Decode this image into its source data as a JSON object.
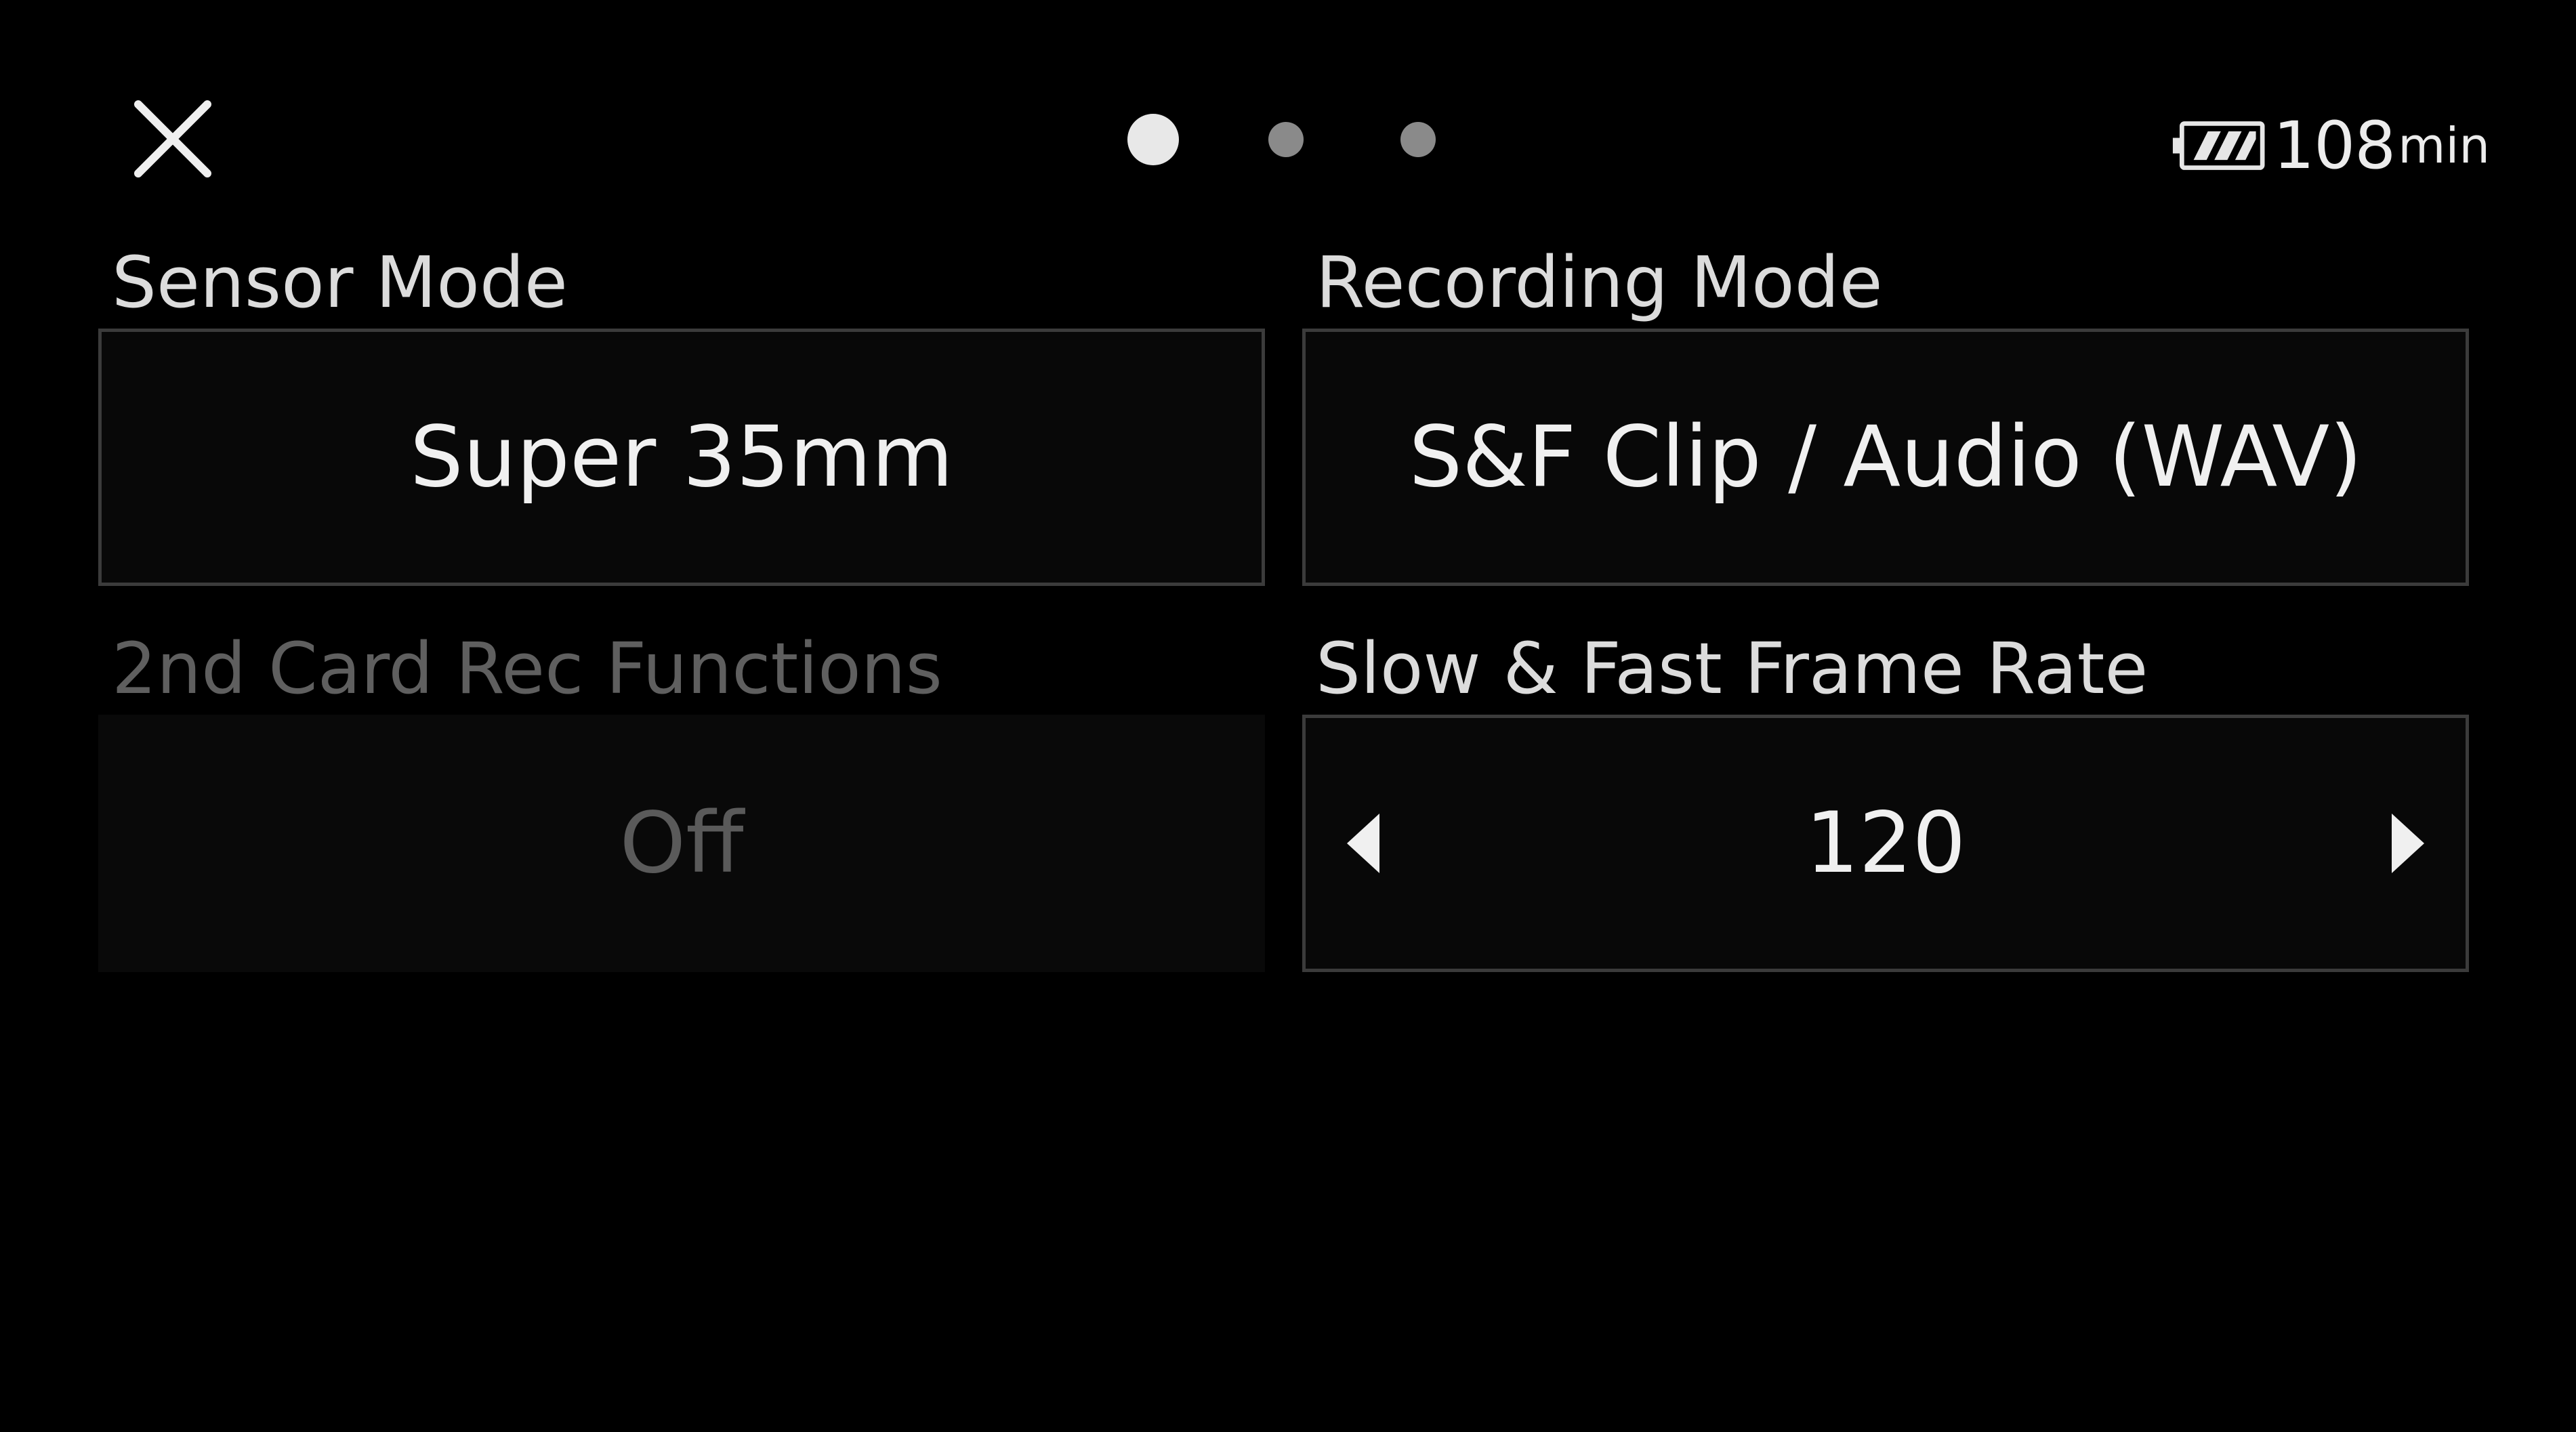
{
  "header": {
    "close_icon": "close-icon",
    "pager": {
      "total": 3,
      "active_index": 0
    },
    "battery": {
      "icon": "battery-icon",
      "value": "108",
      "unit": "min"
    }
  },
  "settings": {
    "sensor_mode": {
      "label": "Sensor Mode",
      "value": "Super 35mm"
    },
    "recording_mode": {
      "label": "Recording Mode",
      "value": "S&F Clip / Audio (WAV)"
    },
    "second_card": {
      "label": "2nd Card Rec Functions",
      "value": "Off",
      "enabled": false
    },
    "slow_fast_rate": {
      "label": "Slow & Fast Frame Rate",
      "value": "120",
      "decrement_icon": "triangle-left-icon",
      "increment_icon": "triangle-right-icon"
    }
  },
  "colors": {
    "background": "#000000",
    "text": "#e6e6e6",
    "disabled_text": "#5f5f5f",
    "box_border": "#3b3b3b"
  }
}
